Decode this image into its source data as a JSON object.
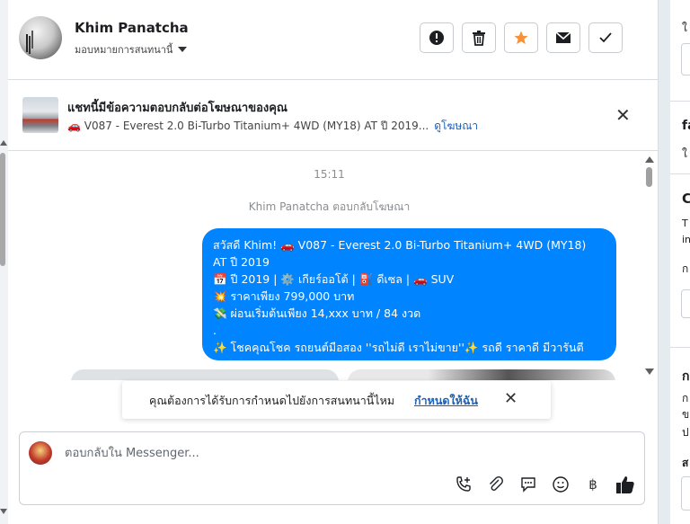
{
  "header": {
    "contact_name": "Khim Panatcha",
    "assign_label": "มอบหมายการสนทนานี้",
    "actions": [
      {
        "name": "report-button",
        "icon": "alert-circle-icon"
      },
      {
        "name": "delete-button",
        "icon": "trash-icon"
      },
      {
        "name": "star-button",
        "icon": "star-icon",
        "color": "#f7923a"
      },
      {
        "name": "email-button",
        "icon": "envelope-icon"
      },
      {
        "name": "done-button",
        "icon": "check-icon"
      }
    ]
  },
  "ad": {
    "title": "แชทนี้มีข้อความตอบกลับต่อโฆษณาของคุณ",
    "subtitle": "🚗 V087 - Everest 2.0 Bi-Turbo Titanium+ 4WD (MY18) AT ปี 2019...",
    "link": "ดูโฆษณา"
  },
  "chat": {
    "timestamp": "15:11",
    "system_note": "Khim Panatcha ตอบกลับโฆษณา",
    "message_lines": [
      "สวัสดี Khim! 🚗 V087 -  Everest 2.0 Bi-Turbo Titanium+ 4WD (MY18)",
      "AT ปี 2019",
      "📅 ปี 2019 | ⚙️ เกียร์ออโต้ | ⛽ ดีเซล | 🚗 SUV",
      "💥 ราคาเพียง 799,000 บาท",
      "💸 ผ่อนเริ่มต้นเพียง 14,xxx บาท / 84 งวด",
      ".",
      "✨ โชคคุณโชค รถยนต์มือสอง ''รถไม่ดี เราไม่ขาย''✨ รถดี ราคาดี มีวารันตี"
    ]
  },
  "toast": {
    "text": "คุณต้องการได้รับการกำหนดไปยังการสนทนานี้ไหม",
    "link": "กำหนดให้ฉัน"
  },
  "composer": {
    "placeholder": "ตอบกลับใน Messenger...",
    "tools": [
      "add-call-icon",
      "paperclip-icon",
      "saved-reply-icon",
      "emoji-icon",
      "baht-icon",
      "thumbs-up-icon"
    ]
  },
  "right_panel": {
    "snippets": [
      "ใ",
      "fa",
      "ใ",
      "C",
      "T",
      "in",
      "ก",
      "ก",
      "ก",
      "ข",
      "ป",
      "ส"
    ]
  },
  "colors": {
    "bubble": "#0084ff",
    "link": "#1d60b6",
    "star": "#f7923a"
  }
}
